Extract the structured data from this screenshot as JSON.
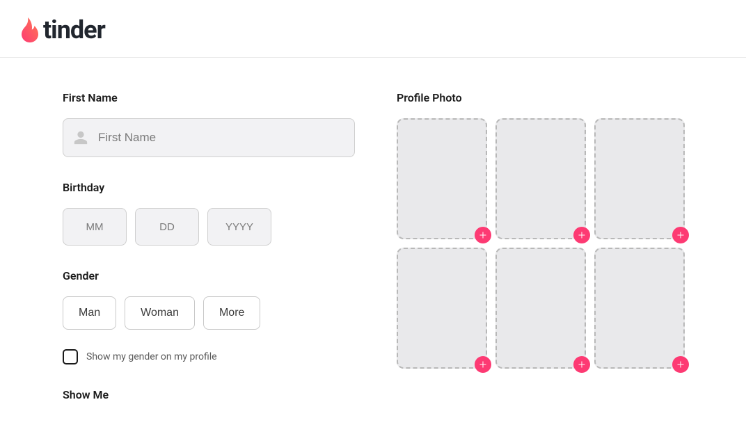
{
  "brand": {
    "name": "tinder",
    "accent": "#fd3a73",
    "accent2": "#ff7854"
  },
  "form": {
    "first_name": {
      "label": "First Name",
      "placeholder": "First Name",
      "value": ""
    },
    "birthday": {
      "label": "Birthday",
      "mm_placeholder": "MM",
      "dd_placeholder": "DD",
      "yyyy_placeholder": "YYYY",
      "mm": "",
      "dd": "",
      "yyyy": ""
    },
    "gender": {
      "label": "Gender",
      "options": [
        "Man",
        "Woman",
        "More"
      ],
      "show_label": "Show my gender on my profile",
      "show_checked": false
    },
    "show_me": {
      "label": "Show Me"
    }
  },
  "photos": {
    "label": "Profile Photo",
    "slot_count": 6
  }
}
